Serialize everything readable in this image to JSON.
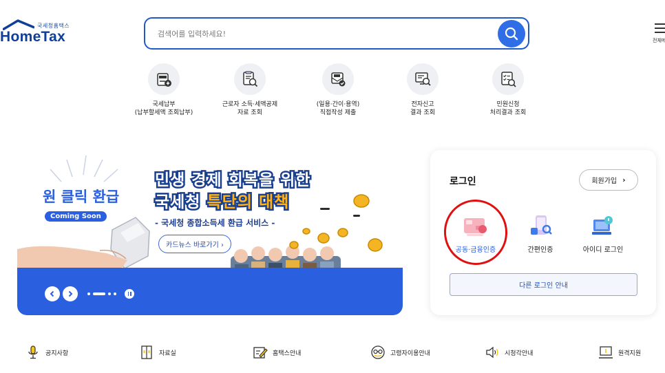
{
  "header": {
    "logo_small": "국세청홈택스",
    "logo_main": "HomeTax",
    "search_placeholder": "검색어를 입력하세요!",
    "allmenu_label": "전체메뉴"
  },
  "quick_services": [
    {
      "line1": "국세납부",
      "line2": "(납부할세액 조회납부)",
      "icon": "tax-payment-icon"
    },
    {
      "line1": "근로자 소득·세액공제",
      "line2": "자료 조회",
      "icon": "document-search-icon"
    },
    {
      "line1": "(일용·간이·용역)",
      "line2": "직접작성 제출",
      "icon": "tax-envelope-check-icon"
    },
    {
      "line1": "전자신고",
      "line2": "결과 조회",
      "icon": "monitor-search-icon"
    },
    {
      "line1": "민원신청",
      "line2": "처리결과 조회",
      "icon": "checklist-search-icon"
    }
  ],
  "banner": {
    "headline1": "민생 경제 회복을 위한",
    "headline2_prefix": "국세청 ",
    "headline2_highlight": "특단의 대책",
    "subtitle": "- 국세청 종합소득세 환급 서비스 -",
    "cardnews": "카드뉴스 바로가기",
    "oneclick": "원 클릭 환급",
    "coming_soon": "Coming Soon"
  },
  "login": {
    "title": "로그인",
    "join": "회원가입",
    "methods": [
      {
        "label": "공동·금융인증",
        "icon": "certificate-card-icon"
      },
      {
        "label": "간편인증",
        "icon": "phone-auth-icon"
      },
      {
        "label": "아이디 로그인",
        "icon": "id-login-monitor-icon"
      }
    ],
    "other": "다른 로그인 안내"
  },
  "bottom_links": [
    {
      "label": "공지사항",
      "icon": "microphone-icon"
    },
    {
      "label": "자료실",
      "icon": "cabinet-icon"
    },
    {
      "label": "홈택스안내",
      "icon": "guide-edit-icon"
    },
    {
      "label": "고령자이용안내",
      "icon": "elderly-icon"
    },
    {
      "label": "시청각안내",
      "icon": "speaker-icon"
    },
    {
      "label": "원격지원",
      "icon": "remote-support-icon"
    }
  ],
  "colors": {
    "brand_blue": "#2a5fdf",
    "logo_navy": "#0f3f99",
    "annotation_red": "#e01010",
    "highlight_orange": "#ffb21a"
  }
}
